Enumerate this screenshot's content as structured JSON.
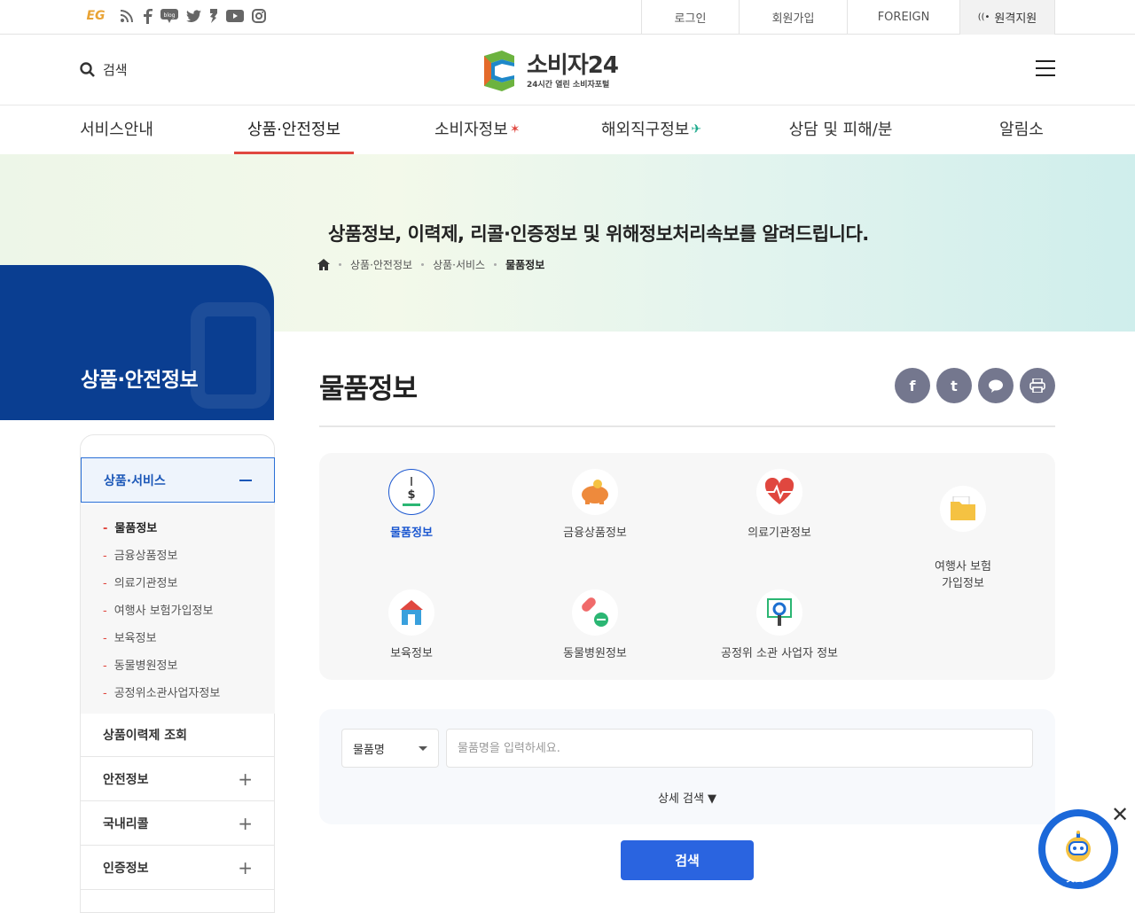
{
  "topbar": {
    "social_icons": [
      "eg-icon",
      "rss-icon",
      "facebook-icon",
      "blog-icon",
      "twitter-icon",
      "kakaostory-icon",
      "youtube-icon",
      "instagram-icon"
    ],
    "eg_label": "EG",
    "blog_label": "blog",
    "login": "로그인",
    "join": "회원가입",
    "foreign": "FOREIGN",
    "remote": "원격지원"
  },
  "header": {
    "search_label": "검색",
    "logo_title": "소비자24",
    "logo_sub": "24시간 열린 소비자포털"
  },
  "gnb": {
    "items": [
      "서비스안내",
      "상품·안전정보",
      "소비자정보",
      "해외직구정보",
      "상담 및 피해/분쟁",
      "알림소식"
    ],
    "active_index": 1
  },
  "hero": {
    "text": "상품정보, 이력제, 리콜·인증정보 및 위해정보처리속보를 알려드립니다.",
    "breadcrumb": [
      "상품·안전정보",
      "상품·서비스",
      "물품정보"
    ]
  },
  "lnb": {
    "title": "상품·안전정보",
    "open_menu": "상품·서비스",
    "sub_items": [
      "물품정보",
      "금융상품정보",
      "의료기관정보",
      "여행사 보험가입정보",
      "보육정보",
      "동물병원정보",
      "공정위소관사업자정보"
    ],
    "rows": [
      "상품이력제 조회",
      "안전정보",
      "국내리콜",
      "인증정보"
    ]
  },
  "content": {
    "page_title": "물품정보",
    "share_icons": [
      "facebook-share-icon",
      "twitter-share-icon",
      "talk-share-icon",
      "print-icon"
    ],
    "categories": [
      {
        "label": "물품정보",
        "icon": "scale-icon"
      },
      {
        "label": "금융상품정보",
        "icon": "piggy-bank-icon"
      },
      {
        "label": "의료기관정보",
        "icon": "heart-pulse-icon"
      },
      {
        "label": "여행사 보험\n가입정보",
        "icon": "folder-icon"
      },
      {
        "label": "보육정보",
        "icon": "house-icon"
      },
      {
        "label": "동물병원정보",
        "icon": "pill-icon"
      },
      {
        "label": "공정위 소관 사업자 정보",
        "icon": "magnifier-icon"
      }
    ],
    "search": {
      "select_value": "물품명",
      "placeholder": "물품명을 입력하세요.",
      "advanced": "상세 검색 ▼",
      "submit": "검색"
    }
  },
  "chatbot": {
    "label": "챗봇"
  },
  "colors": {
    "brand_blue": "#0a3e91",
    "accent_red": "#e0473f",
    "button_blue": "#2a64e0"
  }
}
